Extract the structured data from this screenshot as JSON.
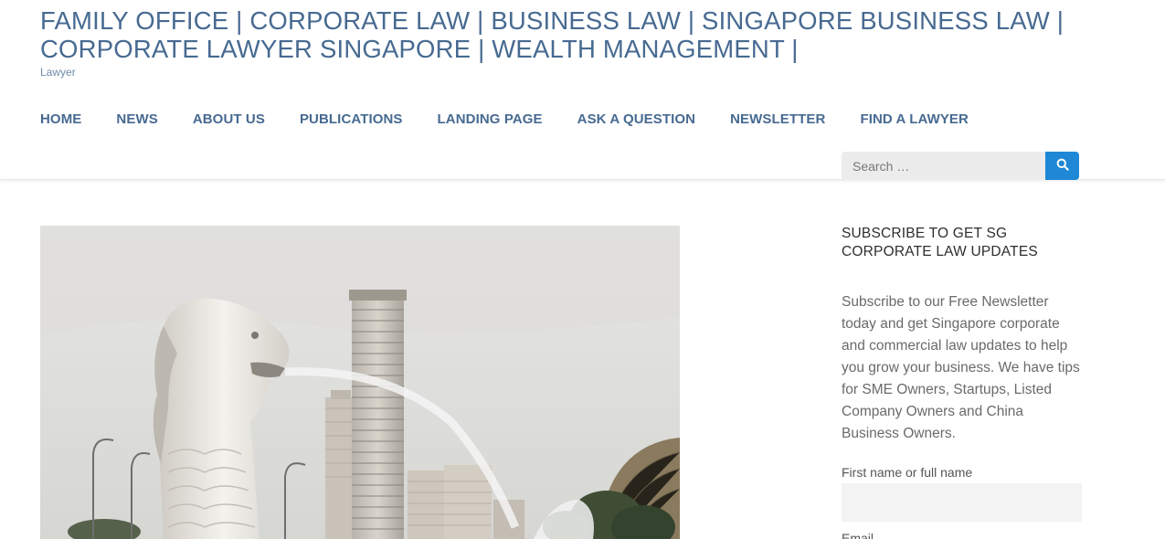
{
  "site": {
    "title": "FAMILY OFFICE | CORPORATE LAW | BUSINESS LAW | SINGAPORE BUSINESS LAW | CORPORATE LAWYER SINGAPORE | WEALTH MANAGEMENT |",
    "tagline": "Lawyer"
  },
  "nav": {
    "items": [
      {
        "label": "HOME"
      },
      {
        "label": "NEWS"
      },
      {
        "label": "ABOUT US"
      },
      {
        "label": "PUBLICATIONS"
      },
      {
        "label": "LANDING PAGE"
      },
      {
        "label": "ASK A QUESTION"
      },
      {
        "label": "NEWSLETTER"
      },
      {
        "label": "FIND A LAWYER"
      }
    ]
  },
  "search": {
    "placeholder": "Search …",
    "icon": "search-icon"
  },
  "hero": {
    "image": "merlion-singapore-skyline-photo"
  },
  "sidebar": {
    "widget_title": "SUBSCRIBE TO GET SG CORPORATE LAW UPDATES",
    "widget_text": "Subscribe to our Free Newsletter today and get Singapore corporate and commercial law updates to help you grow your business. We have tips for SME Owners, Startups, Listed Company Owners and China Business Owners.",
    "name_label": "First name or full name",
    "email_label": "Email"
  },
  "colors": {
    "brand": "#476a91",
    "search_button": "#1e88d6"
  }
}
